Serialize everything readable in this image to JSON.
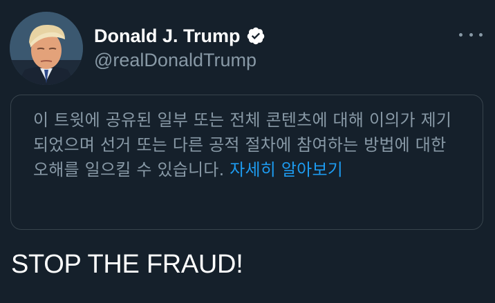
{
  "user": {
    "display_name": "Donald J. Trump",
    "handle": "@realDonaldTrump",
    "verified": true
  },
  "icons": {
    "avatar": "profile-photo",
    "verified": "verified-badge-icon",
    "more": "more-options-icon"
  },
  "notice": {
    "text": "이 트윗에 공유된 일부 또는 전체 콘텐츠에 대해 이의가 제기되었으며 선거 또는 다른 공적 절차에 참여하는 방법에 대한 오해를 일으킬 수 있습니다. ",
    "link_text": "자세히 알아보기"
  },
  "tweet": {
    "text": "STOP THE FRAUD!"
  },
  "colors": {
    "background": "#15202b",
    "secondary_text": "#8899a6",
    "link": "#1d9bf0",
    "border": "#38444d"
  }
}
